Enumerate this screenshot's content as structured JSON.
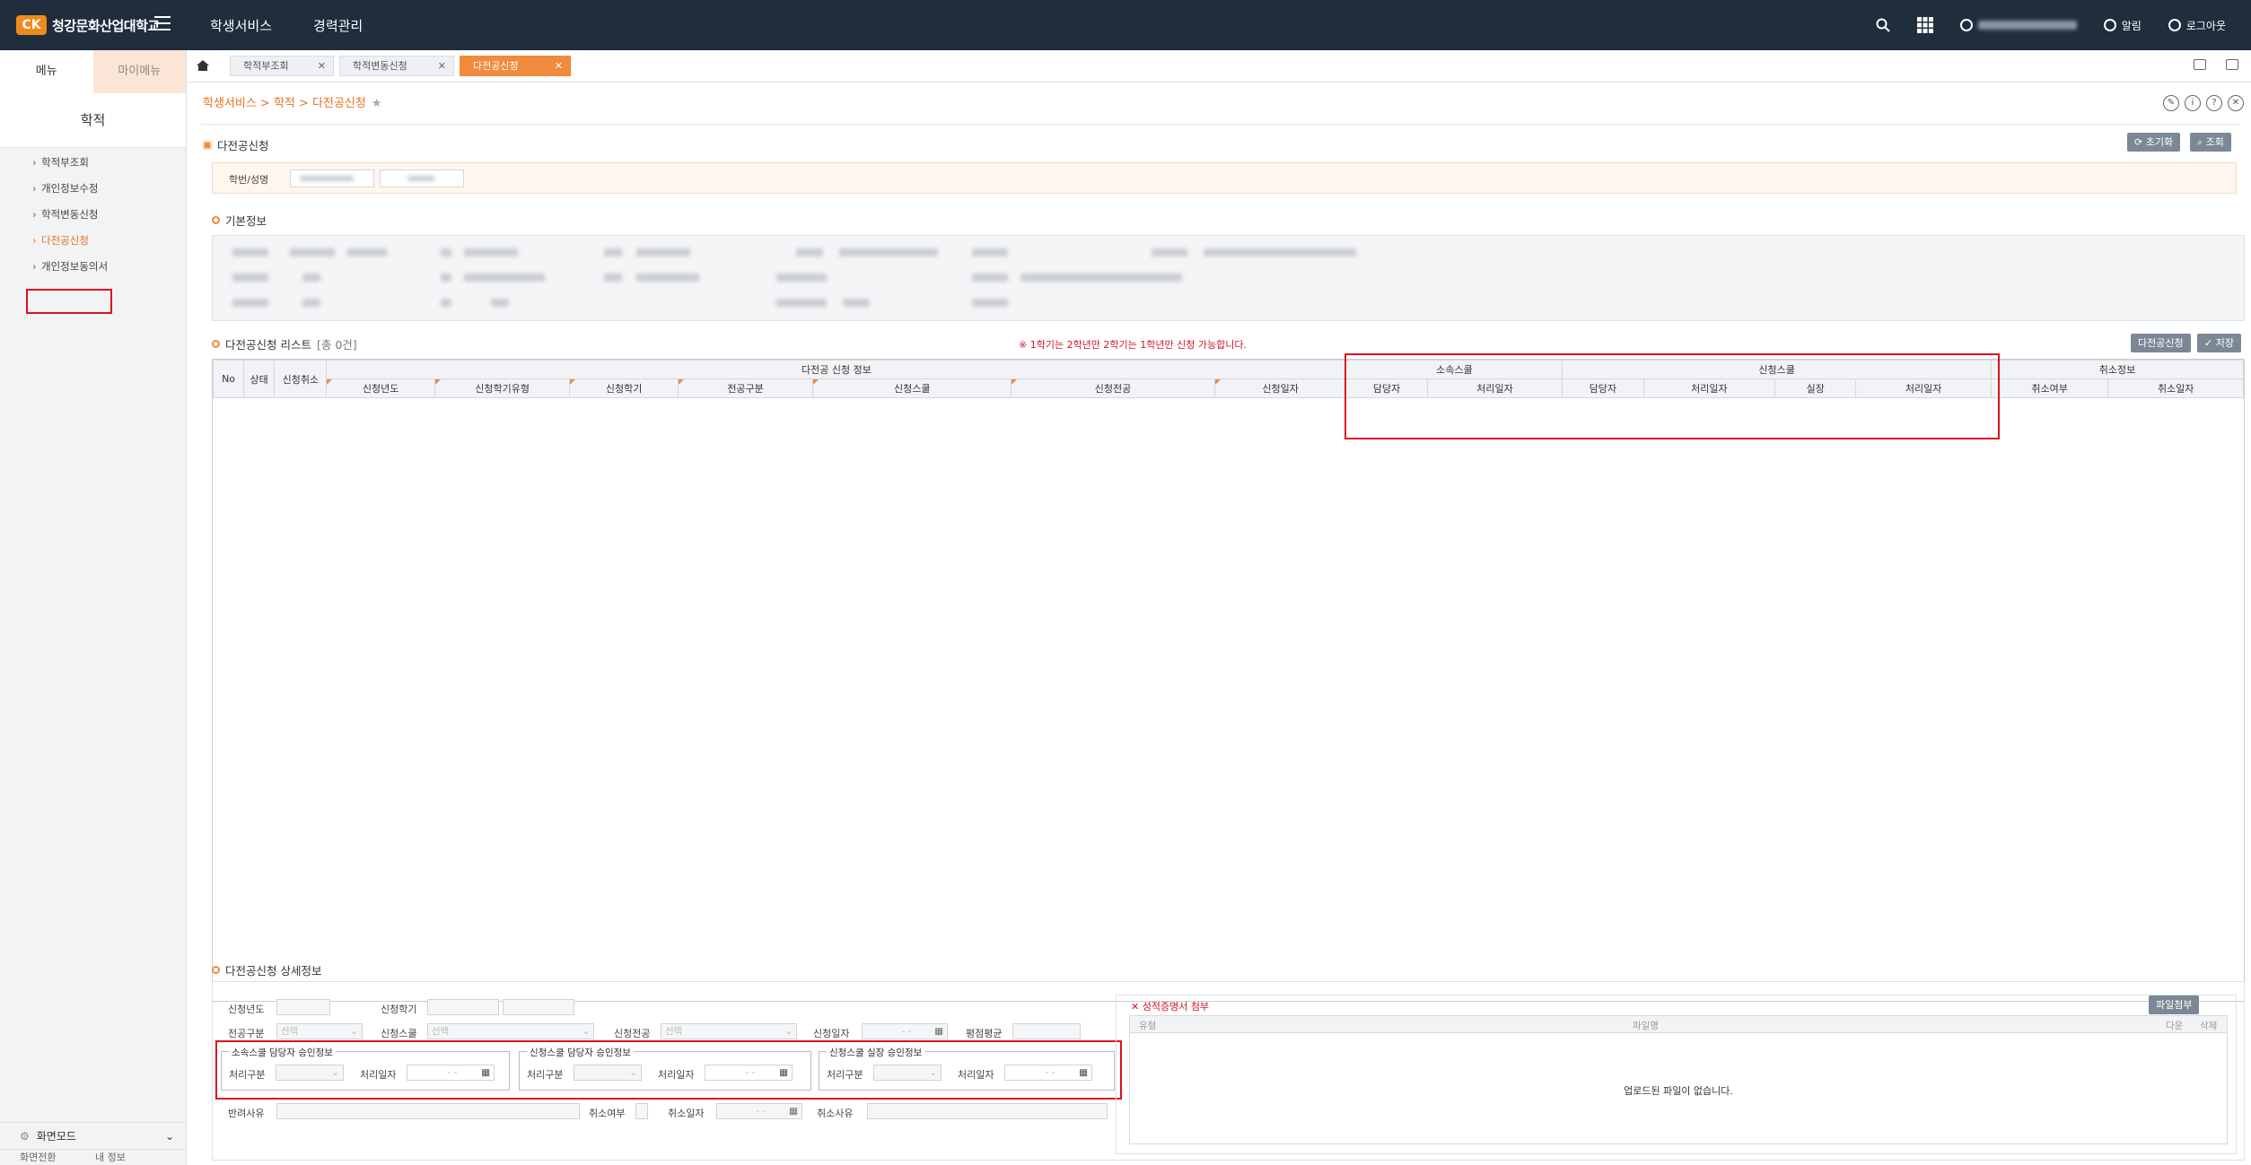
{
  "header": {
    "logo_mark": "CK",
    "university": "청강문화산업대학교",
    "nav": [
      "학생서비스",
      "경력관리"
    ],
    "alarm": "알림",
    "logout": "로그아웃"
  },
  "sidebar": {
    "tabs": [
      "메뉴",
      "마이메뉴"
    ],
    "section_title": "학적",
    "items": [
      {
        "label": "학적부조회"
      },
      {
        "label": "개인정보수정"
      },
      {
        "label": "학적변동신청"
      },
      {
        "label": "다전공신청"
      },
      {
        "label": "개인정보동의서"
      }
    ],
    "screen_mode": "화면모드",
    "bottom_extra": [
      "화면전환",
      "내 정보"
    ]
  },
  "tabs": [
    "학적부조회",
    "학적변동신청",
    "다전공신청"
  ],
  "breadcrumb": "학생서비스 > 학적 > 다전공신청",
  "page": {
    "title": "다전공신청",
    "reset_button": "초기화",
    "search_button": "조회",
    "search_label": "학번/성명",
    "basic_info_title": "기본정보"
  },
  "list": {
    "title": "다전공신청 리스트",
    "count": "[총 0건]",
    "notice": "※ 1학기는 2학년만 2학기는 1학년만 신청 가능합니다.",
    "apply_button": "다전공신청",
    "save_button": "저장",
    "group_headers": [
      "다전공 신청 정보",
      "소속스쿨",
      "신청스쿨",
      "취소정보"
    ],
    "columns": [
      "No",
      "상태",
      "신청취소",
      "신청년도",
      "신청학기유형",
      "신청학기",
      "전공구분",
      "신청스쿨",
      "신청전공",
      "신청일자",
      "담당자",
      "처리일자",
      "담당자",
      "처리일자",
      "실장",
      "처리일자",
      "취소여부",
      "취소일자"
    ]
  },
  "detail": {
    "title": "다전공신청 상세정보",
    "labels": {
      "year": "신청년도",
      "semester": "신청학기",
      "major_type": "전공구분",
      "school": "신청스쿨",
      "major": "신청전공",
      "date": "신청일자",
      "gpa": "평점평균",
      "reject_reason": "반려사유",
      "cancel_yn": "취소여부",
      "cancel_date": "취소일자",
      "cancel_reason": "취소사유"
    },
    "select_placeholder": "선택",
    "date_placeholder": "- -",
    "approval_groups": [
      {
        "legend": "소속스쿨 담당자 승인정보",
        "type_label": "처리구분",
        "date_label": "처리일자"
      },
      {
        "legend": "신청스쿨 담당자 승인정보",
        "type_label": "처리구분",
        "date_label": "처리일자"
      },
      {
        "legend": "신청스쿨 실장 승인정보",
        "type_label": "처리구분",
        "date_label": "처리일자"
      }
    ],
    "attach": {
      "title": "성적증명서 첨부",
      "button": "파일첨부",
      "col_type": "유형",
      "col_name": "파일명",
      "col_down": "다운",
      "col_delete": "삭제",
      "empty": "업로드된 파일이 없습니다."
    }
  }
}
